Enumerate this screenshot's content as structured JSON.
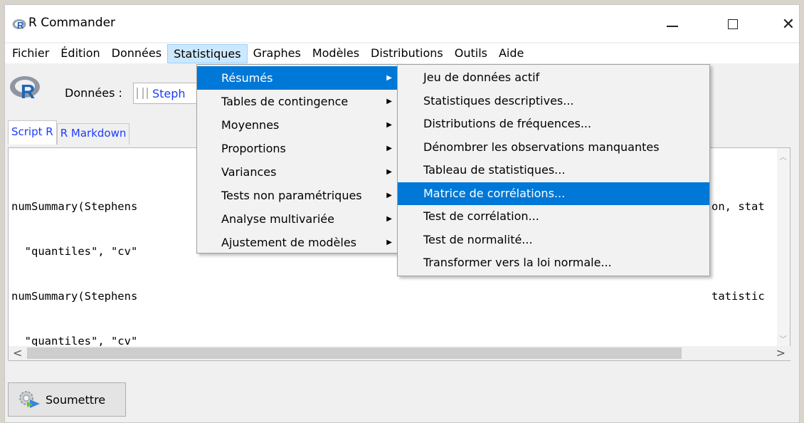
{
  "window": {
    "title": "R Commander",
    "controls": {
      "minimize": "—",
      "maximize": "☐",
      "close": "✕"
    }
  },
  "menubar": {
    "items": [
      "Fichier",
      "Édition",
      "Données",
      "Statistiques",
      "Graphes",
      "Modèles",
      "Distributions",
      "Outils",
      "Aide"
    ],
    "open_item": "Statistiques"
  },
  "toolbar": {
    "data_label": "Données :",
    "dataset_value": "Steph"
  },
  "tabs": [
    "Script R",
    "R Markdown"
  ],
  "script": {
    "lines_left": [
      "numSummary(Stephens",
      "  \"quantiles\", \"cv\"",
      "numSummary(Stephens",
      "  \"quantiles\", \"cv\""
    ],
    "lines_right": [
      "on, stat",
      "",
      "tatistic",
      ""
    ]
  },
  "submit_label": "Soumettre",
  "statistiques_menu": [
    {
      "label": "Résumés",
      "submenu": true,
      "highlighted": true
    },
    {
      "label": "Tables de contingence",
      "submenu": true
    },
    {
      "label": "Moyennes",
      "submenu": true
    },
    {
      "label": "Proportions",
      "submenu": true
    },
    {
      "label": "Variances",
      "submenu": true
    },
    {
      "label": "Tests non paramétriques",
      "submenu": true
    },
    {
      "label": "Analyse multivariée",
      "submenu": true
    },
    {
      "label": "Ajustement de modèles",
      "submenu": true
    }
  ],
  "resumes_menu": [
    {
      "label": "Jeu de données actif"
    },
    {
      "label": "Statistiques descriptives..."
    },
    {
      "label": "Distributions de fréquences..."
    },
    {
      "label": "Dénombrer les observations manquantes"
    },
    {
      "label": "Tableau de statistiques..."
    },
    {
      "label": "Matrice de corrélations...",
      "highlighted": true
    },
    {
      "label": "Test de corrélation..."
    },
    {
      "label": "Test de normalité..."
    },
    {
      "label": "Transformer vers la loi normale..."
    }
  ],
  "colors": {
    "highlight": "#0078d7",
    "menu_open_bg": "#cce8ff",
    "link_blue": "#1a3cff"
  }
}
